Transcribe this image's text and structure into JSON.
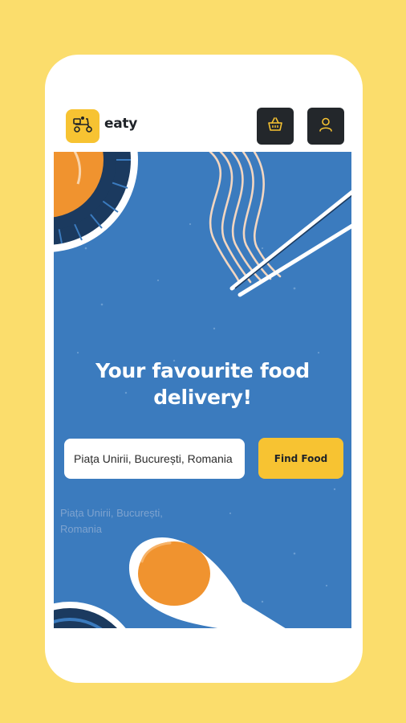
{
  "brand": {
    "name": "eaty"
  },
  "icons": {
    "logo": "delivery-scooter-icon",
    "cart": "basket-icon",
    "user": "user-icon"
  },
  "hero": {
    "headline": "Your favourite food delivery!",
    "search": {
      "value": "Piața Unirii, București, Romania",
      "placeholder": ""
    },
    "find_button_label": "Find Food",
    "suggestion": "Piața Unirii, București, Romania"
  },
  "colors": {
    "page_background": "#FBDD6C",
    "hero_background": "#3B7BBE",
    "accent": "#F7C332",
    "dark_button": "#23272b",
    "orange": "#F0932F",
    "navy": "#163457"
  }
}
